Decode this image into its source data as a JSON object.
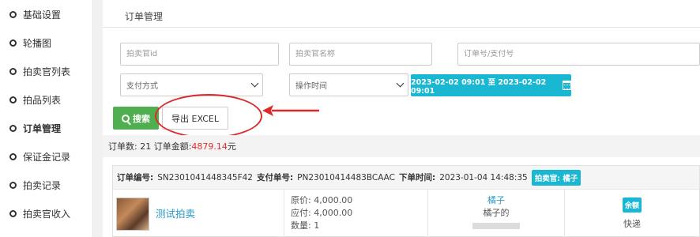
{
  "sidebar": {
    "items": [
      {
        "label": "基础设置"
      },
      {
        "label": "轮播图"
      },
      {
        "label": "拍卖官列表"
      },
      {
        "label": "拍品列表"
      },
      {
        "label": "订单管理"
      },
      {
        "label": "保证金记录"
      },
      {
        "label": "拍卖记录"
      },
      {
        "label": "拍卖官收入"
      }
    ],
    "active_index": 4
  },
  "page": {
    "title": "订单管理"
  },
  "filters": {
    "auctioneer_id_placeholder": "拍卖官id",
    "auctioneer_name_placeholder": "拍卖官名称",
    "order_no_placeholder": "订单号/支付号",
    "pay_method_selected": "支付方式",
    "op_time_selected": "操作时间",
    "date_range": "2023-02-02 09:01 至 2023-02-02 09:01"
  },
  "actions": {
    "search_label": "搜索",
    "export_label": "导出 EXCEL"
  },
  "summary": {
    "prefix": "订单数: 21 订单金额: ",
    "amount": "4879.14",
    "suffix": "元"
  },
  "order": {
    "order_no_label": "订单编号:",
    "order_no": "SN2301041448345F42",
    "pay_no_label": "支付单号:",
    "pay_no": "PN23010414483BCAAC",
    "time_label": "下单时间:",
    "time": "2023-01-04 14:48:35",
    "auctioneer_badge": "拍卖官: 橘子",
    "item_title": "测试拍卖",
    "original_price": "原价: 4,000.00",
    "payable": "应付: 4,000.00",
    "quantity": "数量: 1",
    "buyer_name": "橘子",
    "buyer_sub": "橘子的",
    "pay_badge": "余额",
    "shipping": "快递"
  },
  "colors": {
    "accent": "#1ab7d3",
    "success": "#4fae4f",
    "annotation": "#e0282a",
    "amount": "#e02d2d"
  }
}
